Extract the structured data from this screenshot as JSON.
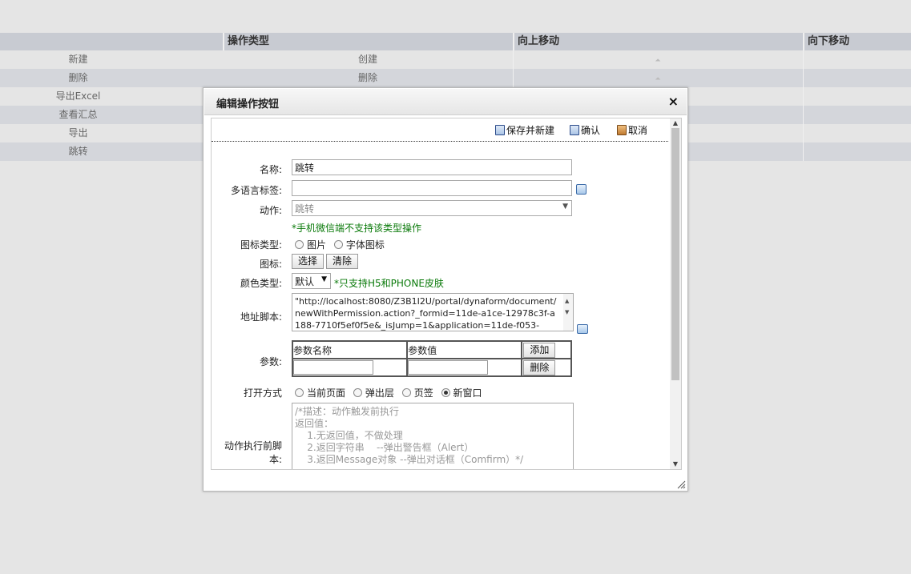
{
  "table": {
    "headers": [
      "操作类型",
      "向上移动",
      "向下移动"
    ],
    "rows": [
      {
        "name": "新建",
        "type": "创建"
      },
      {
        "name": "删除",
        "type": "删除"
      },
      {
        "name": "导出Excel",
        "type": ""
      },
      {
        "name": "查看汇总",
        "type": ""
      },
      {
        "name": "导出",
        "type": ""
      },
      {
        "name": "跳转",
        "type": ""
      }
    ]
  },
  "dialog": {
    "title": "编辑操作按钮",
    "close": "×",
    "toolbar": {
      "save_new": "保存并新建",
      "confirm": "确认",
      "cancel": "取消"
    },
    "form": {
      "name_label": "名称:",
      "name_value": "跳转",
      "i18n_label": "多语言标签:",
      "i18n_value": "",
      "action_label": "动作:",
      "action_value": "跳转",
      "action_note": "*手机微信端不支持该类型操作",
      "icon_type_label": "图标类型:",
      "icon_type_options": [
        "图片",
        "字体图标"
      ],
      "icon_label": "图标:",
      "icon_select": "选择",
      "icon_clear": "清除",
      "color_label": "颜色类型:",
      "color_value": "默认",
      "color_note": "*只支持H5和PHONE皮肤",
      "url_label": "地址脚本:",
      "url_value": "\"http://localhost:8080/Z3B1I2U/portal/dynaform/document/newWithPermission.action?_formid=11de-a1ce-12978c3f-a188-7710f5ef0f5e&_isJump=1&application=11de-f053-",
      "params_label": "参数:",
      "params_col_name": "参数名称",
      "params_col_value": "参数值",
      "params_add": "添加",
      "params_delete": "删除",
      "open_label": "打开方式",
      "open_options": [
        "当前页面",
        "弹出层",
        "页签",
        "新窗口"
      ],
      "script_label": "动作执行前脚本:",
      "script_value": "/*描述：动作触发前执行\n返回值：\n    1.无返回值，不做处理\n    2.返回字符串    --弹出警告框（Alert）\n    3.返回Message对象 --弹出对话框（Comfirm）*/"
    }
  }
}
